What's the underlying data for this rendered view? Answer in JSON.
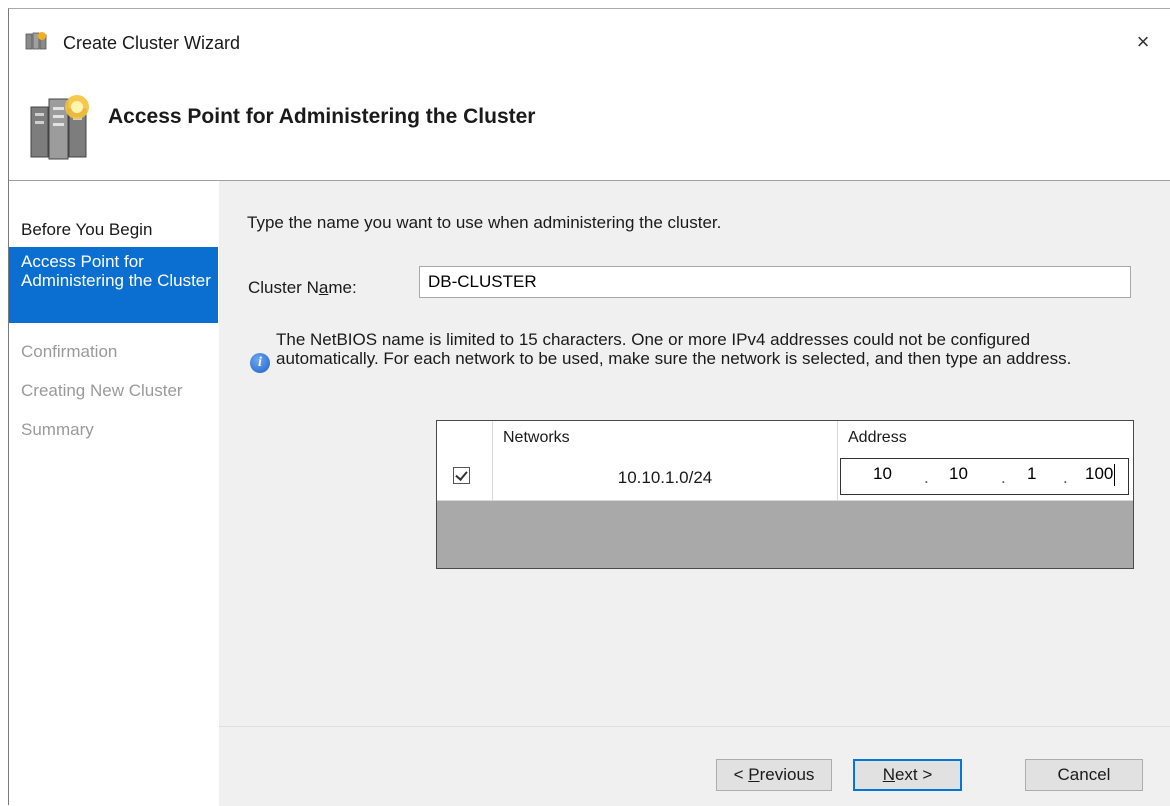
{
  "window": {
    "title": "Create Cluster Wizard",
    "app_icon": "cluster-wizard-icon",
    "close_label": "×"
  },
  "header": {
    "title": "Access Point for Administering the Cluster",
    "icon": "cluster-servers-icon"
  },
  "nav": {
    "items": [
      {
        "label": "Before You Begin",
        "state": "done"
      },
      {
        "label": "Access Point for Administering the Cluster",
        "state": "active"
      },
      {
        "label": "Confirmation",
        "state": "pending"
      },
      {
        "label": "Creating New Cluster",
        "state": "pending"
      },
      {
        "label": "Summary",
        "state": "pending"
      }
    ]
  },
  "main": {
    "instruction": "Type the name you want to use when administering the cluster.",
    "cluster_name_label_pre": "Cluster N",
    "cluster_name_label_key": "a",
    "cluster_name_label_post": "me:",
    "cluster_name_value": "DB-CLUSTER",
    "info_text": "The NetBIOS name is limited to 15 characters.  One or more IPv4 addresses could not be configured automatically.  For each network to be used, make sure the network is selected, and then type an address.",
    "info_icon": "info-icon"
  },
  "grid": {
    "headers": {
      "networks": "Networks",
      "address": "Address"
    },
    "rows": [
      {
        "checked": true,
        "network": "10.10.1.0/24",
        "octets": [
          "10",
          "10",
          "1",
          "100"
        ]
      }
    ],
    "dot": "."
  },
  "buttons": {
    "previous_pre": "< ",
    "previous_key": "P",
    "previous_post": "revious",
    "next_key": "N",
    "next_post": "ext >",
    "cancel": "Cancel"
  },
  "colors": {
    "accent": "#0a6fd1",
    "panel": "#f0f0f0",
    "grid_empty": "#a9a9a9"
  }
}
